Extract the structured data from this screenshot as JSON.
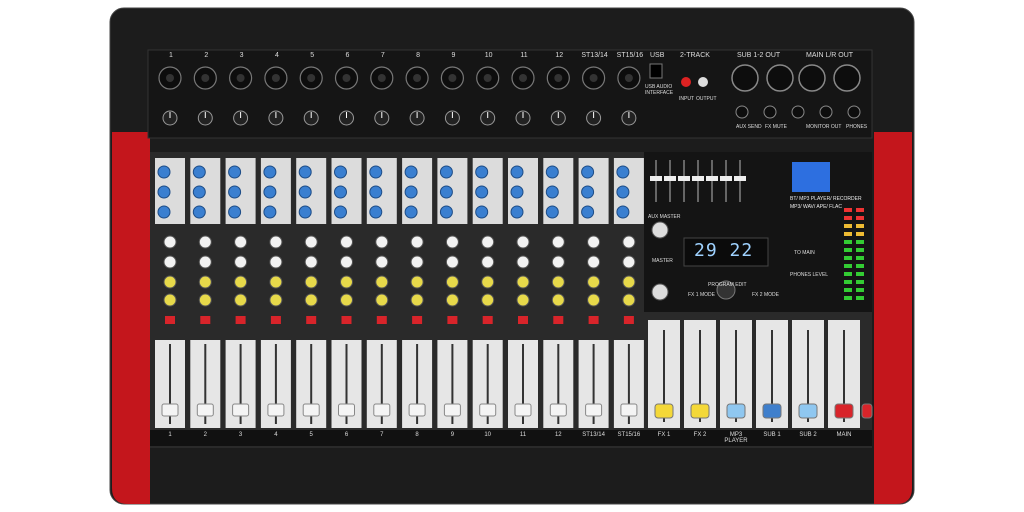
{
  "colors": {
    "body": "#1b1b1b",
    "side_panel": "#c4161c",
    "face": "#e8e8e8",
    "knob_blue": "#3a7fd0",
    "knob_white": "#f2f2f2",
    "knob_yellow": "#e7d94a",
    "fader_white": "#f4f4f4",
    "fader_yellow": "#f4d838",
    "fader_lightblue": "#8fc7f0",
    "fader_blue": "#3f7fcc",
    "fader_red": "#d8242a",
    "lcd": "#2d6fe0"
  },
  "channels": [
    "1",
    "2",
    "3",
    "4",
    "5",
    "6",
    "7",
    "8",
    "9",
    "10",
    "11",
    "12",
    "ST13/14",
    "ST15/16"
  ],
  "top_labels": {
    "usb": "USB",
    "two_track": "2-TRACK",
    "sub_out": "SUB 1-2 OUT",
    "main_out": "MAIN L/R OUT",
    "usb_interface": "USB AUDIO INTERFACE",
    "input": "INPUT",
    "output": "OUTPUT",
    "aux_send": "AUX SEND",
    "fx_mute": "FX MUTE",
    "monitor_out": "MONITOR OUT",
    "phones": "PHONES"
  },
  "player": {
    "title": "BT/ MP3 PLAYER/ RECORDER",
    "formats": "MP3/ WAV/ APE/ FLAC"
  },
  "fx": {
    "display": "29 22",
    "aux_master": "AUX MASTER",
    "master": "MASTER",
    "program_edit": "PROGRAM EDIT",
    "fx1_mode": "FX 1 MODE",
    "fx2_mode": "FX 2 MODE"
  },
  "master_section": {
    "phones_level": "PHONES LEVEL",
    "to_main": "TO MAIN"
  },
  "bottom_labels": [
    "1",
    "2",
    "3",
    "4",
    "5",
    "6",
    "7",
    "8",
    "9",
    "10",
    "11",
    "12",
    "ST13/14",
    "ST15/16",
    "FX 1",
    "FX 2",
    "MP3 PLAYER",
    "SUB 1",
    "SUB 2",
    "MAIN"
  ]
}
